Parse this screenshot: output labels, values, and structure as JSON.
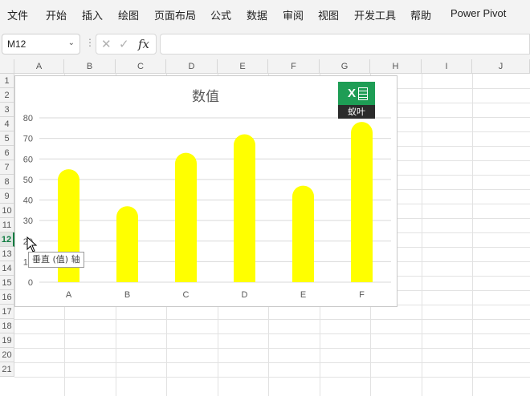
{
  "menu": {
    "items": [
      "文件",
      "开始",
      "插入",
      "绘图",
      "页面布局",
      "公式",
      "数据",
      "审阅",
      "视图",
      "开发工具",
      "帮助",
      "Power Pivot"
    ]
  },
  "formula_bar": {
    "name_box": "M12",
    "formula": ""
  },
  "grid": {
    "columns": [
      "A",
      "B",
      "C",
      "D",
      "E",
      "F",
      "G",
      "H",
      "I",
      "J"
    ],
    "rows": [
      "1",
      "2",
      "3",
      "4",
      "5",
      "6",
      "7",
      "8",
      "9",
      "10",
      "11",
      "12",
      "13",
      "14",
      "15",
      "16",
      "17",
      "18",
      "19",
      "20",
      "21"
    ],
    "active_row": "12"
  },
  "badge": {
    "label": "蚁叶"
  },
  "tooltip": {
    "text": "垂直 (值) 轴"
  },
  "chart_data": {
    "type": "bar",
    "title": "数值",
    "categories": [
      "A",
      "B",
      "C",
      "D",
      "E",
      "F"
    ],
    "values": [
      55,
      37,
      63,
      72,
      47,
      78
    ],
    "ylim": [
      0,
      80
    ],
    "yticks": [
      "0",
      "10",
      "20",
      "30",
      "40",
      "50",
      "60",
      "70",
      "80"
    ],
    "xlabel": "",
    "ylabel": "",
    "grid": true,
    "bar_color": "#ffff00"
  }
}
